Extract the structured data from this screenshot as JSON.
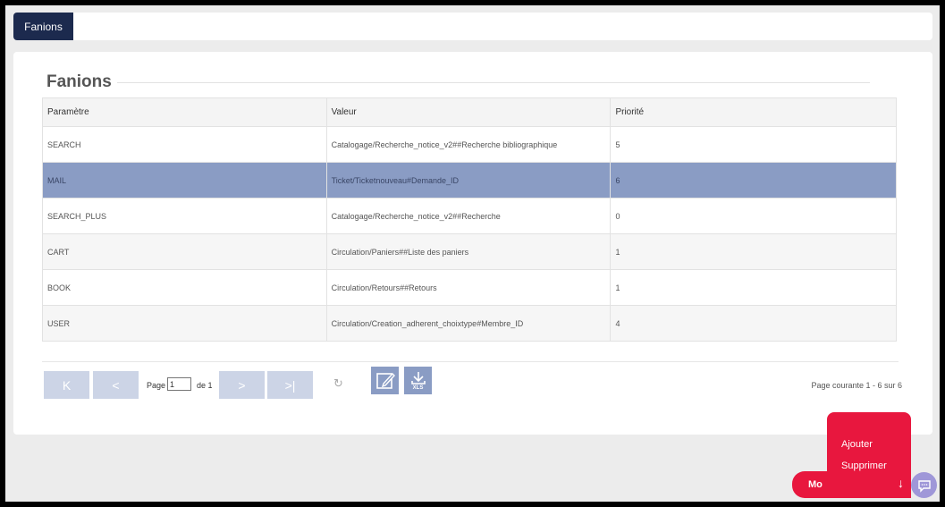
{
  "tabs": [
    {
      "label": "Fanions"
    }
  ],
  "card": {
    "title": "Fanions"
  },
  "table": {
    "headers": [
      "Paramètre",
      "Valeur",
      "Priorité"
    ],
    "rows": [
      [
        "SEARCH",
        "Catalogage/Recherche_notice_v2##Recherche bibliographique",
        "5"
      ],
      [
        "MAIL",
        "Ticket/Ticketnouveau#Demande_ID",
        "6"
      ],
      [
        "SEARCH_PLUS",
        "Catalogage/Recherche_notice_v2##Recherche",
        "0"
      ],
      [
        "CART",
        "Circulation/Paniers##Liste des paniers",
        "1"
      ],
      [
        "BOOK",
        "Circulation/Retours##Retours",
        "1"
      ],
      [
        "USER",
        "Circulation/Creation_adherent_choixtype#Membre_ID",
        "4"
      ]
    ],
    "selected_row": 1
  },
  "pager": {
    "first": "K",
    "prev": "<",
    "next": ">",
    "last": ">|",
    "page_label": "Page",
    "page_value": "1",
    "of_label": "de 1",
    "status": "Page courante 1 - 6 sur 6",
    "xls_label": "XLS"
  },
  "menu": {
    "items": [
      "Ajouter",
      "Supprimer"
    ],
    "button_label": "Mo",
    "button_arrow": "↓"
  },
  "colors": {
    "accent_dark": "#1c2a4e",
    "selected_row": "#8a9cc4",
    "action_red": "#e8173e",
    "chat_purple": "#9f97d8"
  }
}
